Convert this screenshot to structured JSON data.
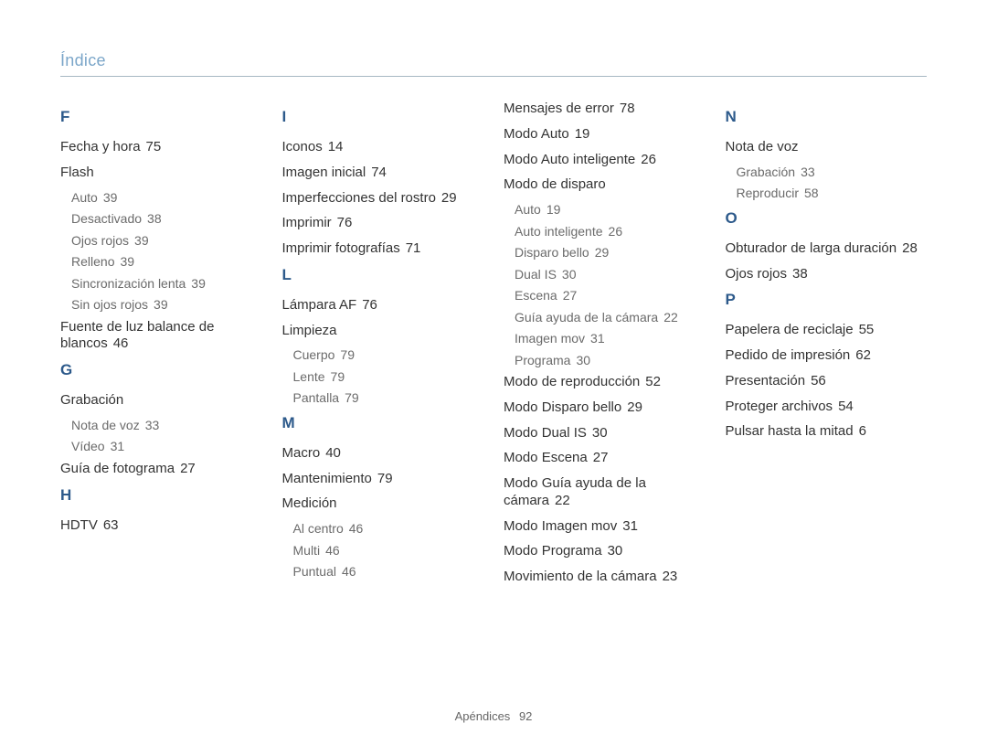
{
  "title": "Índice",
  "footer": {
    "label": "Apéndices",
    "page": "92"
  },
  "columns": [
    {
      "sections": [
        {
          "letter": "F",
          "items": [
            {
              "label": "Fecha y hora",
              "page": "75"
            },
            {
              "label": "Flash",
              "children": [
                {
                  "label": "Auto",
                  "page": "39"
                },
                {
                  "label": "Desactivado",
                  "page": "38"
                },
                {
                  "label": "Ojos rojos",
                  "page": "39"
                },
                {
                  "label": "Relleno",
                  "page": "39"
                },
                {
                  "label": "Sincronización lenta",
                  "page": "39"
                },
                {
                  "label": "Sin ojos rojos",
                  "page": "39"
                }
              ]
            },
            {
              "label": "Fuente de luz balance de blancos",
              "page": "46"
            }
          ]
        },
        {
          "letter": "G",
          "items": [
            {
              "label": "Grabación",
              "children": [
                {
                  "label": "Nota de voz",
                  "page": "33"
                },
                {
                  "label": "Vídeo",
                  "page": "31"
                }
              ]
            },
            {
              "label": "Guía de fotograma",
              "page": "27"
            }
          ]
        },
        {
          "letter": "H",
          "items": [
            {
              "label": "HDTV",
              "page": "63"
            }
          ]
        }
      ]
    },
    {
      "sections": [
        {
          "letter": "I",
          "items": [
            {
              "label": "Iconos",
              "page": "14"
            },
            {
              "label": "Imagen inicial",
              "page": "74"
            },
            {
              "label": "Imperfecciones del rostro",
              "page": "29"
            },
            {
              "label": "Imprimir",
              "page": "76"
            },
            {
              "label": "Imprimir fotografías",
              "page": "71"
            }
          ]
        },
        {
          "letter": "L",
          "items": [
            {
              "label": "Lámpara AF",
              "page": "76"
            },
            {
              "label": "Limpieza",
              "children": [
                {
                  "label": "Cuerpo",
                  "page": "79"
                },
                {
                  "label": "Lente",
                  "page": "79"
                },
                {
                  "label": "Pantalla",
                  "page": "79"
                }
              ]
            }
          ]
        },
        {
          "letter": "M",
          "items": [
            {
              "label": "Macro",
              "page": "40"
            },
            {
              "label": "Mantenimiento",
              "page": "79"
            },
            {
              "label": "Medición",
              "children": [
                {
                  "label": "Al centro",
                  "page": "46"
                },
                {
                  "label": "Multi",
                  "page": "46"
                },
                {
                  "label": "Puntual",
                  "page": "46"
                }
              ]
            }
          ]
        }
      ]
    },
    {
      "sections": [
        {
          "letter": "",
          "items": [
            {
              "label": "Mensajes de error",
              "page": "78"
            },
            {
              "label": "Modo Auto",
              "page": "19"
            },
            {
              "label": "Modo Auto inteligente",
              "page": "26"
            },
            {
              "label": "Modo de disparo",
              "children": [
                {
                  "label": "Auto",
                  "page": "19"
                },
                {
                  "label": "Auto inteligente",
                  "page": "26"
                },
                {
                  "label": "Disparo bello",
                  "page": "29"
                },
                {
                  "label": "Dual IS",
                  "page": "30"
                },
                {
                  "label": "Escena",
                  "page": "27"
                },
                {
                  "label": "Guía ayuda de la cámara",
                  "page": "22"
                },
                {
                  "label": "Imagen mov",
                  "page": "31"
                },
                {
                  "label": "Programa",
                  "page": "30"
                }
              ]
            },
            {
              "label": "Modo de reproducción",
              "page": "52"
            },
            {
              "label": "Modo Disparo bello",
              "page": "29"
            },
            {
              "label": "Modo Dual IS",
              "page": "30"
            },
            {
              "label": "Modo Escena",
              "page": "27"
            },
            {
              "label": "Modo Guía ayuda de la cámara",
              "page": "22"
            },
            {
              "label": "Modo Imagen mov",
              "page": "31"
            },
            {
              "label": "Modo Programa",
              "page": "30"
            },
            {
              "label": "Movimiento de la cámara",
              "page": "23"
            }
          ]
        }
      ]
    },
    {
      "sections": [
        {
          "letter": "N",
          "items": [
            {
              "label": "Nota de voz",
              "children": [
                {
                  "label": "Grabación",
                  "page": "33"
                },
                {
                  "label": "Reproducir",
                  "page": "58"
                }
              ]
            }
          ]
        },
        {
          "letter": "O",
          "items": [
            {
              "label": "Obturador de larga duración",
              "page": "28"
            },
            {
              "label": "Ojos rojos",
              "page": "38"
            }
          ]
        },
        {
          "letter": "P",
          "items": [
            {
              "label": "Papelera de reciclaje",
              "page": "55"
            },
            {
              "label": "Pedido de impresión",
              "page": "62"
            },
            {
              "label": "Presentación",
              "page": "56"
            },
            {
              "label": "Proteger archivos",
              "page": "54"
            },
            {
              "label": "Pulsar hasta la mitad",
              "page": "6"
            }
          ]
        }
      ]
    }
  ]
}
